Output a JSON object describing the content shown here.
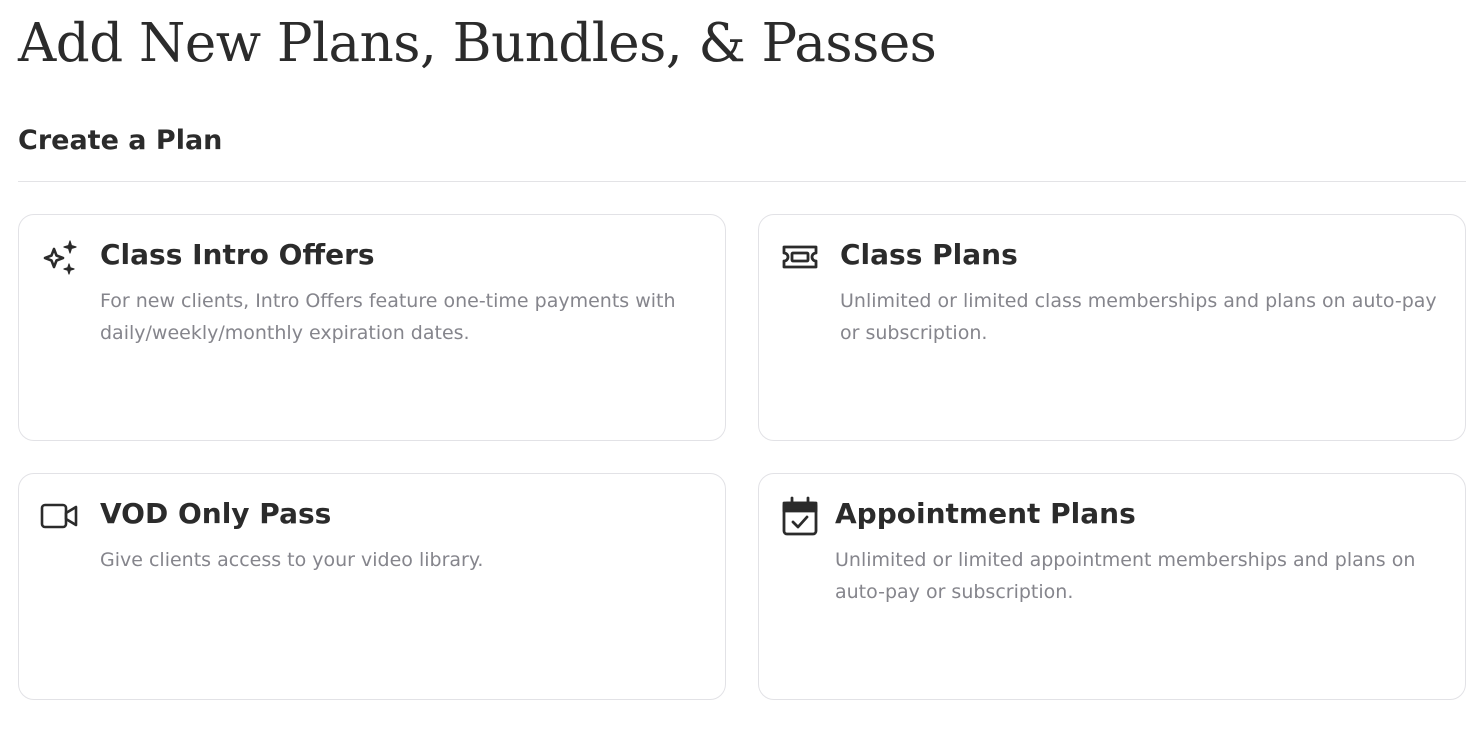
{
  "page": {
    "title": "Add New Plans, Bundles, & Passes",
    "section_title": "Create a Plan"
  },
  "cards": [
    {
      "title": "Class Intro Offers",
      "description": "For new clients, Intro Offers feature one-time payments with daily/weekly/monthly expiration dates.",
      "icon": "sparkles-icon"
    },
    {
      "title": "Class Plans",
      "description": "Unlimited or limited class memberships and plans on auto-pay or subscription.",
      "icon": "ticket-icon"
    },
    {
      "title": "VOD Only Pass",
      "description": "Give clients access to your video library.",
      "icon": "video-camera-icon"
    },
    {
      "title": "Appointment Plans",
      "description": "Unlimited or limited appointment memberships and plans on auto-pay or subscription.",
      "icon": "calendar-check-icon"
    }
  ],
  "colors": {
    "text": "#2b2b2b",
    "muted": "#85858c",
    "border": "#e2e2e6"
  }
}
